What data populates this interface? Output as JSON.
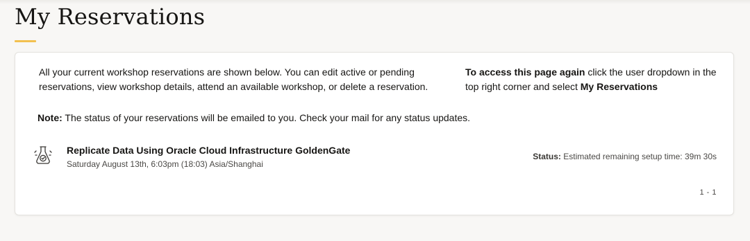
{
  "page": {
    "title": "My Reservations"
  },
  "intro": {
    "left_text": "All your current workshop reservations are shown below. You can edit active or pending reservations, view workshop details, attend an available workshop, or delete a reservation.",
    "right_bold": "To access this page again",
    "right_text_1": " click the user dropdown in the top right corner and select ",
    "right_bold_2": "My Reservations"
  },
  "note": {
    "label": "Note:",
    "text": " The status of your reservations will be emailed to you. Check your mail for any status updates."
  },
  "reservations": [
    {
      "icon": "lab-flask-icon",
      "title": "Replicate Data Using Oracle Cloud Infrastructure GoldenGate",
      "date": "Saturday August 13th, 6:03pm (18:03) Asia/Shanghai",
      "status_label": "Status:",
      "status_text": " Estimated remaining setup time: 39m 30s"
    }
  ],
  "pagination": {
    "range": "1 - 1"
  },
  "colors": {
    "accent_underline": "#f2c04f",
    "page_background": "#f8f7f5",
    "card_background": "#ffffff"
  }
}
